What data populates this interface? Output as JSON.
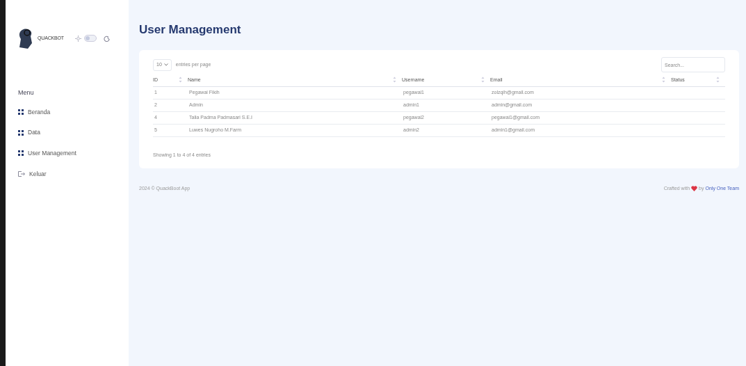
{
  "brand": {
    "name": "QUACKBOT"
  },
  "theme_toggle": {
    "on": false
  },
  "menu": {
    "heading": "Menu",
    "items": [
      {
        "label": "Beranda",
        "kind": "grid"
      },
      {
        "label": "Data",
        "kind": "grid"
      },
      {
        "label": "User Management",
        "kind": "grid"
      },
      {
        "label": "Keluar",
        "kind": "logout"
      }
    ]
  },
  "page_title": "User Management",
  "table": {
    "page_size": "10",
    "page_size_label": "entries per page",
    "search": {
      "placeholder": "Search..."
    },
    "columns": [
      "ID",
      "Name",
      "Username",
      "Email",
      "Status"
    ],
    "rows": [
      [
        "1",
        "Pegawai Fikih",
        "pegawai1",
        "zolzqih@gmail.com",
        ""
      ],
      [
        "2",
        "Admin",
        "admin1",
        "admin@gmail.com",
        ""
      ],
      [
        "4",
        "Talia Padma Padmasari S.E.I",
        "pegawai2",
        "pegawai1@gmail.com",
        ""
      ],
      [
        "5",
        "Luwes Nugroho M.Farm",
        "admin2",
        "admin1@gmail.com",
        ""
      ]
    ],
    "summary": "Showing 1 to 4 of 4 entries"
  },
  "footer": {
    "left": "2024 © QuackBoot App",
    "right_prefix": "Crafted with",
    "right_mid": "by",
    "right_link": "Only One Team"
  }
}
